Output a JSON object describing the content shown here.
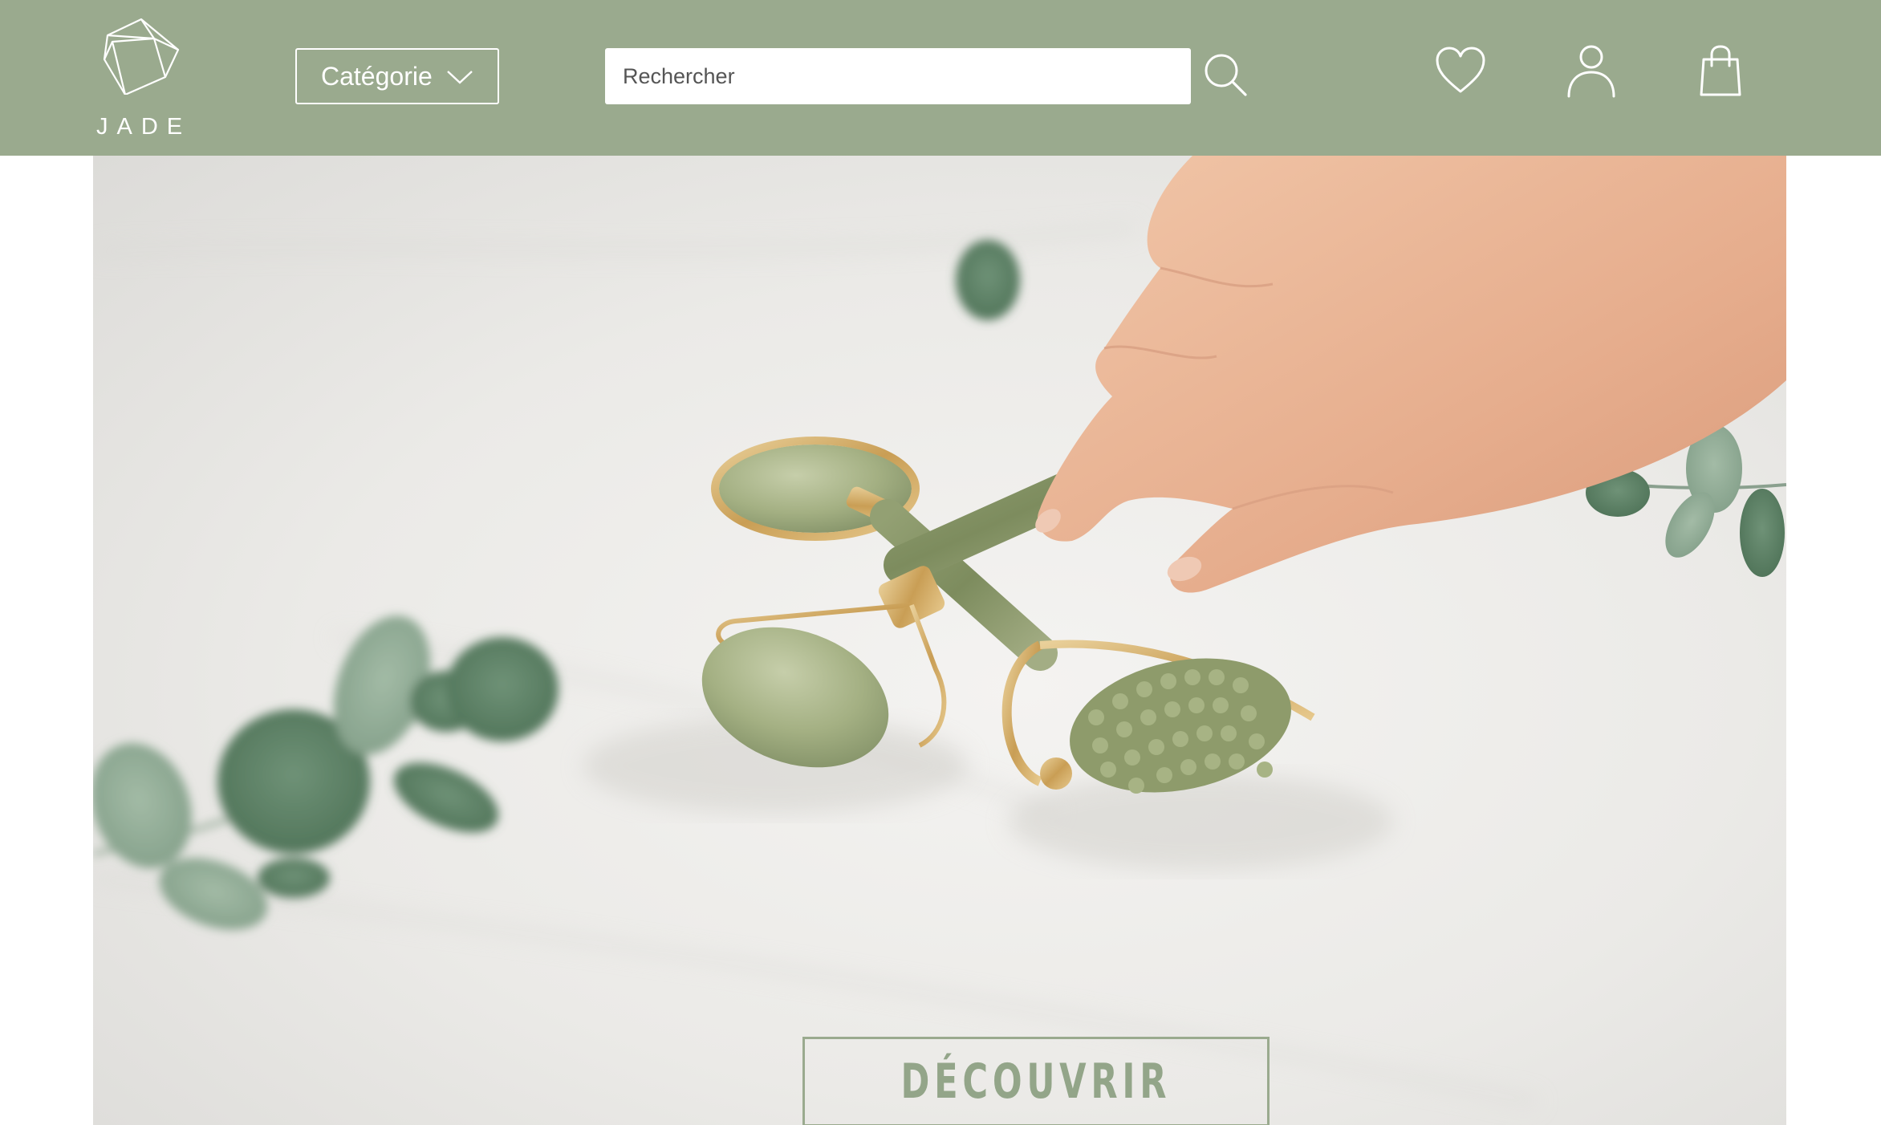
{
  "brand": {
    "name": "JADE",
    "logo_icon": "gem-icon"
  },
  "header": {
    "background_color": "#9aaa8e",
    "category_label": "Catégorie",
    "category_icon": "chevron-down-icon",
    "search": {
      "placeholder": "Rechercher",
      "value": "",
      "icon": "search-icon"
    },
    "actions": [
      {
        "name": "favorites",
        "icon": "heart-icon"
      },
      {
        "name": "account",
        "icon": "user-icon"
      },
      {
        "name": "cart",
        "icon": "shopping-bag-icon"
      }
    ]
  },
  "hero": {
    "image": "jade-rollers-with-eucalyptus-photo",
    "cta_label": "DÉCOUVRIR",
    "cta_color": "#93a589"
  }
}
